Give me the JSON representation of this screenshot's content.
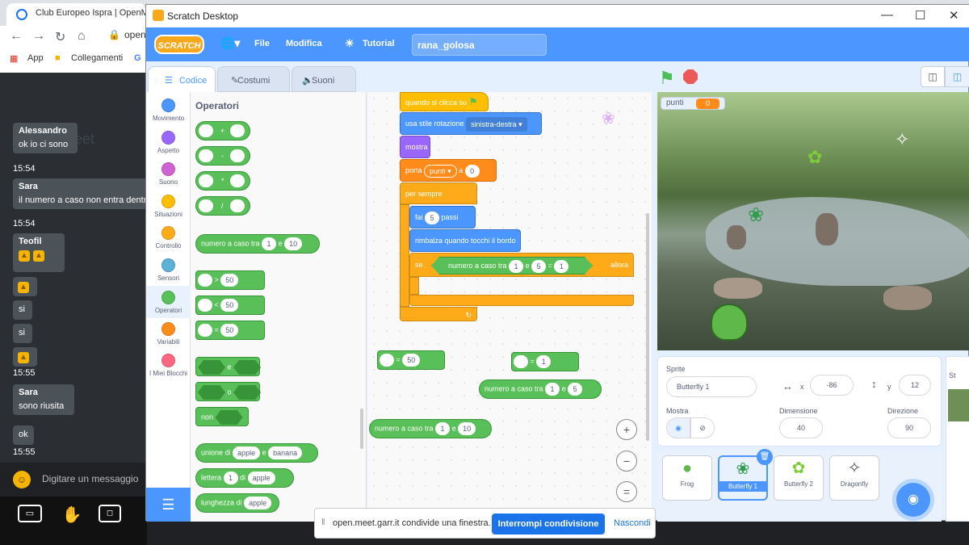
{
  "browser": {
    "tab_title": "Club Europeo Ispra | OpenM...",
    "omnibox": "open",
    "bookmarks": [
      "App",
      "Collegamenti"
    ]
  },
  "chat": {
    "messages": [
      {
        "author": "Alessandro",
        "text": "ok io ci sono",
        "time": "15:54"
      },
      {
        "author": "Sara",
        "text": "il numero a caso non entra dentro",
        "time": "15:54"
      },
      {
        "author": "Teofil",
        "text": "",
        "time": ""
      },
      {
        "author": "",
        "text": "si",
        "time": ""
      },
      {
        "author": "",
        "text": "si",
        "time": "15:55"
      },
      {
        "author": "Sara",
        "text": "sono riusita",
        "time": ""
      },
      {
        "author": "",
        "text": "ok",
        "time": "15:55"
      }
    ],
    "ghost_text": "eet",
    "input_placeholder": "Digitare un messaggio"
  },
  "window": {
    "title": "Scratch Desktop",
    "icon_colors": {
      "logo": "#f7a81b"
    }
  },
  "menubar": {
    "logo": "SCRATCH",
    "file": "File",
    "edit": "Modifica",
    "tutorial": "Tutorial",
    "project_name": "rana_golosa"
  },
  "tabs": {
    "code": "Codice",
    "costumes": "Costumi",
    "sounds": "Suoni"
  },
  "categories": [
    {
      "label": "Movimento",
      "color": "#4c97ff"
    },
    {
      "label": "Aspetto",
      "color": "#9966ff"
    },
    {
      "label": "Suono",
      "color": "#cf63cf"
    },
    {
      "label": "Situazioni",
      "color": "#ffbf00"
    },
    {
      "label": "Controllo",
      "color": "#ffab19"
    },
    {
      "label": "Sensori",
      "color": "#5cb1d6"
    },
    {
      "label": "Operatori",
      "color": "#59c059"
    },
    {
      "label": "Variabili",
      "color": "#ff8c1a"
    },
    {
      "label": "I Miei Blocchi",
      "color": "#ff6680"
    }
  ],
  "palette": {
    "title": "Operatori",
    "ops": [
      "+",
      "-",
      "*",
      "/"
    ],
    "random": {
      "label": "numero a caso tra",
      "a": "1",
      "and": "e",
      "b": "10"
    },
    "cmp": [
      {
        "op": ">",
        "v": "50"
      },
      {
        "op": "<",
        "v": "50"
      },
      {
        "op": "=",
        "v": "50"
      }
    ],
    "logic": [
      "e",
      "o",
      "non"
    ],
    "join": {
      "label": "unione di",
      "a": "apple",
      "and": "e",
      "b": "banana"
    },
    "letter": {
      "label": "lettera",
      "n": "1",
      "of": "di",
      "s": "apple"
    },
    "length": {
      "label": "lunghezza di",
      "s": "apple"
    }
  },
  "script": {
    "hat": "quando si clicca su",
    "rotation": {
      "label": "usa stile rotazione",
      "value": "sinistra-destra"
    },
    "show": "mostra",
    "setvar": {
      "label": "porta",
      "var": "punti",
      "to": "a",
      "val": "0"
    },
    "forever": "per sempre",
    "move": {
      "label": "fai",
      "n": "5",
      "unit": "passi"
    },
    "bounce": "rimbalza quando tocchi il bordo",
    "if": {
      "label": "se",
      "then": "allora",
      "rand": "numero a caso tra",
      "a": "1",
      "and": "e",
      "b": "5",
      "eq": "=",
      "val": "1"
    },
    "loose1": {
      "v": "50",
      "op": "="
    },
    "loose2": {
      "op": "=",
      "v": "1"
    },
    "loose3": {
      "label": "numero a caso tra",
      "a": "1",
      "and": "e",
      "b": "5"
    },
    "loose4": {
      "label": "numero a caso tra",
      "a": "1",
      "and": "e",
      "b": "10"
    }
  },
  "stage": {
    "var_name": "punti",
    "var_value": "0"
  },
  "sprite_info": {
    "sprite_label": "Sprite",
    "sprite_name": "Butterfly 1",
    "x_label": "x",
    "x": "-86",
    "y_label": "y",
    "y": "12",
    "show_label": "Mostra",
    "size_label": "Dimensione",
    "size": "40",
    "direction_label": "Direzione",
    "direction": "90"
  },
  "sprites": [
    "Frog",
    "Butterfly 1",
    "Butterfly 2",
    "Dragonfly"
  ],
  "stage_pane": {
    "label": "St"
  },
  "share_bar": {
    "message": "open.meet.garr.it condivide una finestra.",
    "stop": "Interrompi condivisione",
    "hide": "Nascondi"
  }
}
